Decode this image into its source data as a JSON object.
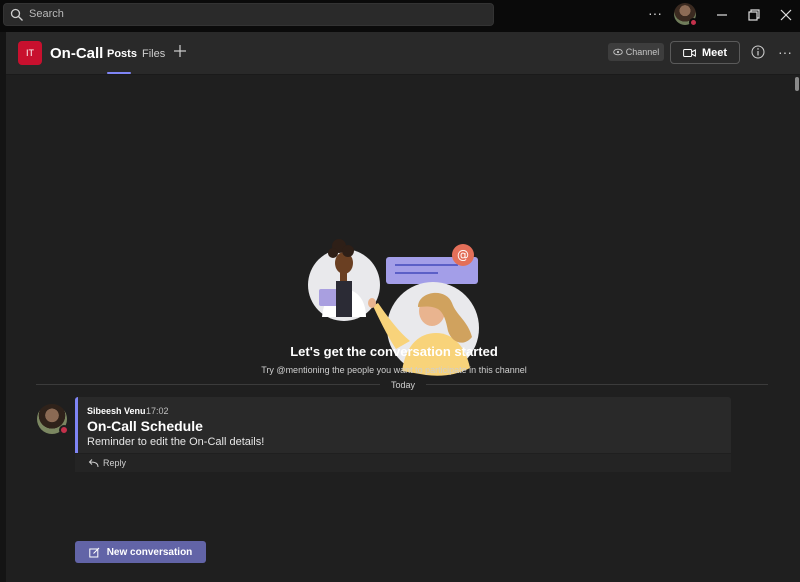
{
  "titlebar": {
    "search_placeholder": "Search",
    "more_label": "···"
  },
  "channel": {
    "team_initials": "IT",
    "team_color": "#c8102e",
    "name": "On-Call",
    "tabs": [
      {
        "label": "Posts",
        "active": true
      },
      {
        "label": "Files",
        "active": false
      }
    ],
    "channel_pill": "Channel",
    "meet_label": "Meet",
    "more_label": "···"
  },
  "empty_state": {
    "title": "Let's get the conversation started",
    "subtitle": "Try @mentioning the people you want to participate in this channel"
  },
  "divider": {
    "label": "Today"
  },
  "message": {
    "author": "Sibeesh Venu",
    "time": "17:02",
    "subject": "On-Call Schedule",
    "body": "Reminder to edit the On-Call details!",
    "reply_label": "Reply"
  },
  "new_conversation": {
    "label": "New conversation"
  },
  "colors": {
    "accent": "#7f85f5",
    "button": "#6264a7",
    "presence_busy": "#c4314b"
  }
}
